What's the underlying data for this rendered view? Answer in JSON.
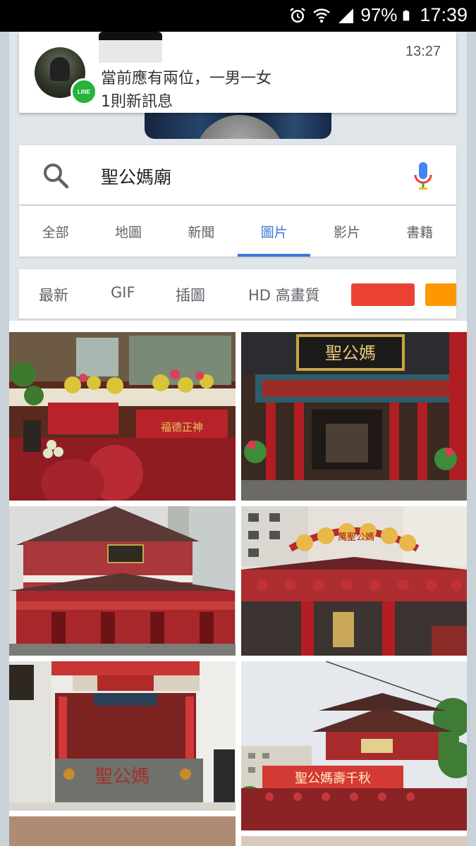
{
  "status_bar": {
    "battery_percent": "97%",
    "time": "17:39",
    "icons": [
      "alarm-icon",
      "wifi-icon",
      "signal-icon",
      "battery-icon"
    ]
  },
  "notification": {
    "app": "LINE",
    "badge_text": "LINE",
    "message": "當前應有兩位，一男一女",
    "summary": "1則新訊息",
    "time": "13:27"
  },
  "search": {
    "query": "聖公媽廟"
  },
  "tabs": [
    {
      "label": "全部"
    },
    {
      "label": "地圖"
    },
    {
      "label": "新聞"
    },
    {
      "label": "圖片",
      "active": true
    },
    {
      "label": "影片"
    },
    {
      "label": "書籍"
    }
  ],
  "filters": {
    "chips": [
      "最新",
      "GIF",
      "插圖",
      "HD 高畫質"
    ],
    "color_swatches": [
      "#ea4335",
      "#ff9800"
    ]
  },
  "images": {
    "sign_board_text": "聖公媽",
    "gate_sign_text": "萬聖公媽",
    "altar_plaque_text": "聖公媽",
    "altar_banner_text": "福德正神",
    "temple_sign_text": "聖公媽壽千秋"
  },
  "colors": {
    "accent": "#3c78d8",
    "line_green": "#25b33e"
  }
}
